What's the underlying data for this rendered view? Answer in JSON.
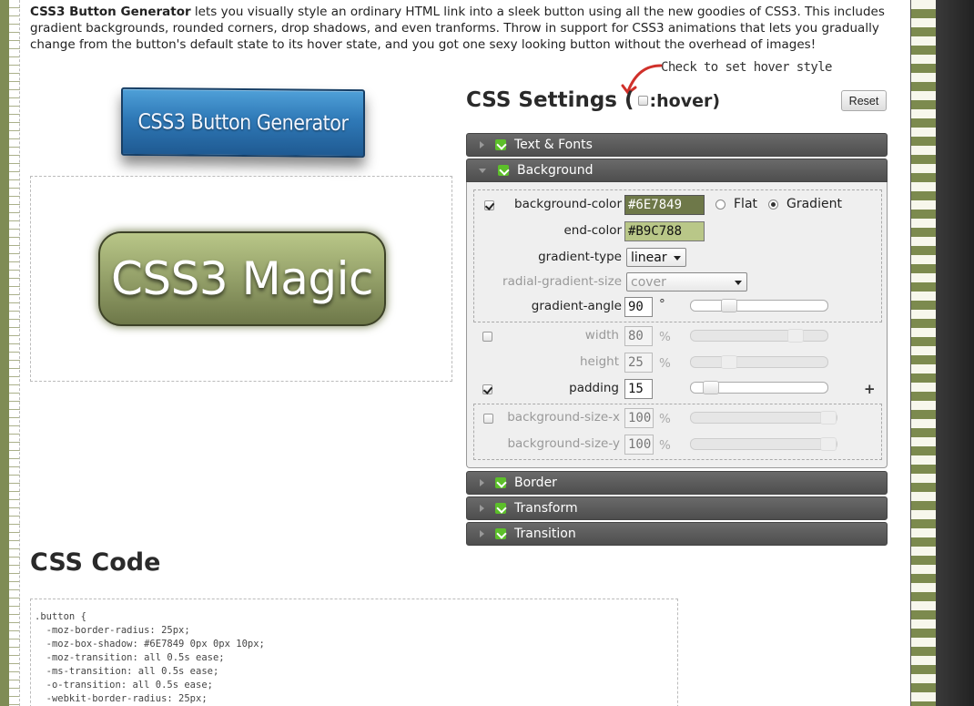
{
  "intro": {
    "title": "CSS3 Button Generator",
    "text": " lets you visually style an ordinary HTML link into a sleek button using all the new goodies of CSS3. This includes gradient backgrounds, rounded corners, drop shadows, and even tranforms. Throw in support for CSS3 animations that lets you gradually change from the button's default state to its hover state, and you got one sexy looking button without the overhead of images!"
  },
  "logo_text": "CSS3 Button Generator",
  "preview_button": "CSS3 Magic",
  "annotation": "Check to set hover style",
  "settings": {
    "title": "CSS Settings",
    "paren_open": "(",
    "hover_label": ":hover)",
    "reset": "Reset"
  },
  "sections": {
    "text_fonts": "Text & Fonts",
    "background": "Background",
    "border": "Border",
    "transform": "Transform",
    "transition": "Transition"
  },
  "background": {
    "background_color_label": "background-color",
    "background_color": "#6E7849",
    "flat": "Flat",
    "gradient": "Gradient",
    "end_color_label": "end-color",
    "end_color": "#B9C788",
    "gradient_type_label": "gradient-type",
    "gradient_type": "linear",
    "radial_size_label": "radial-gradient-size",
    "radial_size": "cover",
    "gradient_angle_label": "gradient-angle",
    "gradient_angle": "90",
    "gradient_angle_unit": "°",
    "width_label": "width",
    "width": "80",
    "height_label": "height",
    "height": "25",
    "padding_label": "padding",
    "padding": "15",
    "bg_size_x_label": "background-size-x",
    "bg_size_x": "100",
    "bg_size_y_label": "background-size-y",
    "bg_size_y": "100",
    "percent": "%",
    "plus": "+"
  },
  "sliders": {
    "gradient_angle_level": 0.25,
    "width_level": 0.8,
    "height_level": 0.25,
    "padding_level": 0.1,
    "bg_size_x_level": 1.0,
    "bg_size_y_level": 1.0
  },
  "code": {
    "title": "CSS Code",
    "lines": [
      ".button {",
      "  -moz-border-radius: 25px;",
      "  -moz-box-shadow: #6E7849 0px 0px 10px;",
      "  -moz-transition: all 0.5s ease;",
      "  -ms-transition: all 0.5s ease;",
      "  -o-transition: all 0.5s ease;",
      "  -webkit-border-radius: 25px;"
    ]
  },
  "colors": {
    "bg_start": "#6E7849",
    "bg_end": "#B9C788",
    "logo_blue": "#2f79b7",
    "section_header": "#555555",
    "green_icon": "#5cbf2a"
  }
}
